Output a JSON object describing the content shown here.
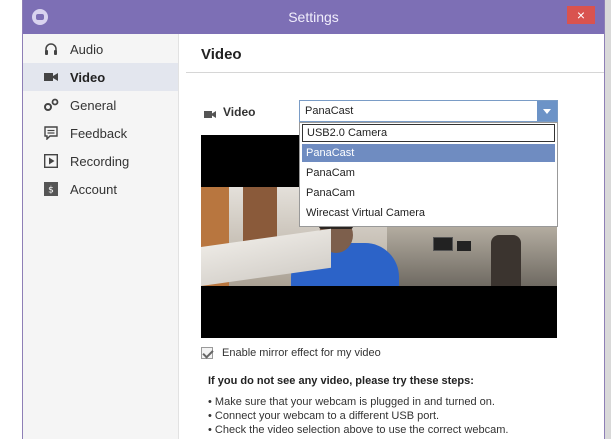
{
  "window": {
    "title": "Settings",
    "close_glyph": "×"
  },
  "sidebar": {
    "items": [
      {
        "label": "Audio",
        "icon": "headphones-icon",
        "selected": false
      },
      {
        "label": "Video",
        "icon": "video-camera-icon",
        "selected": true
      },
      {
        "label": "General",
        "icon": "gears-icon",
        "selected": false
      },
      {
        "label": "Feedback",
        "icon": "feedback-icon",
        "selected": false
      },
      {
        "label": "Recording",
        "icon": "recording-icon",
        "selected": false
      },
      {
        "label": "Account",
        "icon": "account-icon",
        "selected": false
      }
    ]
  },
  "main": {
    "title": "Video",
    "video_label": "Video",
    "camera_select": {
      "value": "PanaCast",
      "options": [
        "USB2.0 Camera",
        "PanaCast",
        "PanaCam",
        "PanaCam",
        "Wirecast Virtual Camera"
      ],
      "highlighted_index": 1,
      "focused_index": 0
    },
    "mirror_label": "Enable mirror effect for my video",
    "help_heading": "If you do not see any video, please try these steps:",
    "help_steps": [
      "Make sure that your webcam is plugged in and turned on.",
      "Connect your webcam to a different USB port.",
      "Check the video selection above to use the correct webcam."
    ]
  },
  "colors": {
    "titlebar": "#7d6fb5",
    "accent": "#6f8cc1",
    "close": "#d9534f"
  }
}
